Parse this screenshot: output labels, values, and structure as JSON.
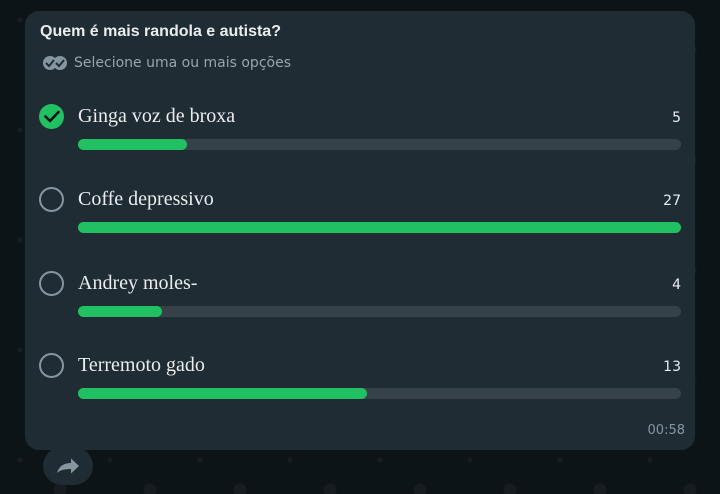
{
  "poll": {
    "question": "Quem é mais randola e autista?",
    "hint": "Selecione uma ou mais opções",
    "hint_icon": "double-check-icon",
    "options": [
      {
        "label": "Ginga voz de broxa",
        "count": "5",
        "checked": true,
        "progress": 0.18
      },
      {
        "label": "Coffe depressivo",
        "count": "27",
        "checked": false,
        "progress": 1.0
      },
      {
        "label": "Andrey moles-",
        "count": "4",
        "checked": false,
        "progress": 0.14
      },
      {
        "label": "Terremoto gado",
        "count": "13",
        "checked": false,
        "progress": 0.48
      }
    ],
    "time": "00:58"
  },
  "actions": {
    "forward_icon": "forward-arrow-icon"
  },
  "colors": {
    "accent": "#21c063",
    "bubble": "#202c33",
    "track": "#374248",
    "text": "#e9edef"
  }
}
